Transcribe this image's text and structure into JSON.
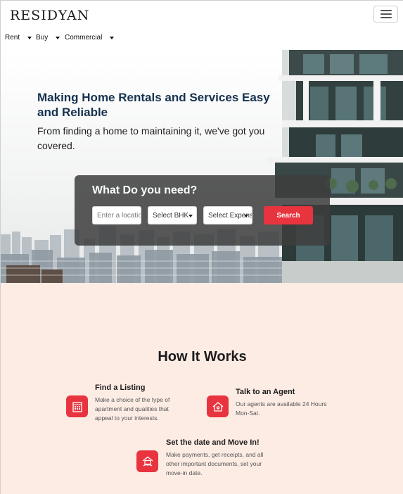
{
  "header": {
    "logo": "RESIDYAN",
    "nav": [
      {
        "label": "Rent"
      },
      {
        "label": "Buy"
      },
      {
        "label": "Commercial"
      }
    ]
  },
  "hero": {
    "title": "Making Home Rentals and Services Easy and Reliable",
    "subtitle": "From finding a home to maintaining it, we've got you covered.",
    "search": {
      "title": "What Do you need?",
      "location_placeholder": "Enter a location",
      "bhk_value": "Select BHK",
      "expense_value": "Select Expense",
      "button_label": "Search"
    }
  },
  "how_it_works": {
    "title": "How It Works",
    "steps": [
      {
        "title": "Find a Listing",
        "text": "Make a choice of the type of apartment and qualities that appeal to your interests.",
        "icon": "building-icon"
      },
      {
        "title": "Talk to an Agent",
        "text": "Our agents are available 24 Hours Mon-Sat.",
        "icon": "house-location-icon"
      },
      {
        "title": "Set the date and Move In!",
        "text": "Make payments, get receipts, and all other important documents, set your move-in date.",
        "icon": "house-handshake-icon"
      }
    ]
  },
  "colors": {
    "accent": "#e8343e",
    "hero_title": "#16324f",
    "section_bg": "#fdece4"
  }
}
